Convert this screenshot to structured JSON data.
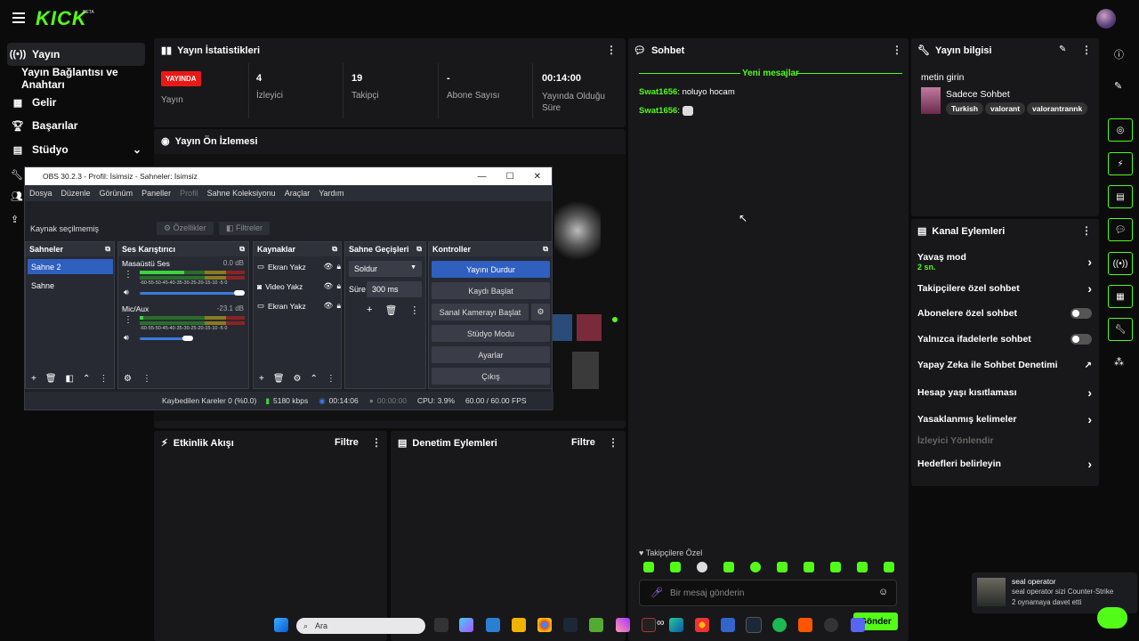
{
  "header": {
    "logo": "KICK",
    "beta": "BETA"
  },
  "nav": {
    "items": [
      {
        "label": "Yayın",
        "icon": "broadcast-icon"
      },
      {
        "label": "Yayın Bağlantısı ve Anahtarı"
      },
      {
        "label": "Gelir",
        "icon": "revenue-icon"
      },
      {
        "label": "Başarılar",
        "icon": "trophy-icon"
      },
      {
        "label": "Stüdyo",
        "icon": "studio-icon"
      }
    ]
  },
  "stats": {
    "title": "Yayın İstatistikleri",
    "live_badge": "YAYINDA",
    "live_label": "Yayın",
    "viewers_value": "4",
    "viewers_label": "İzleyici",
    "followers_value": "19",
    "followers_label": "Takipçi",
    "subs_value": "-",
    "subs_label": "Abone Sayısı",
    "duration_value": "00:14:00",
    "duration_label": "Yayında Olduğu Süre"
  },
  "preview": {
    "title": "Yayın Ön İzlemesi"
  },
  "obs": {
    "window_title": "OBS 30.2.3 - Profil: İsimsiz - Sahneler: İsimsiz",
    "menu": [
      "Dosya",
      "Düzenle",
      "Görünüm",
      "Paneller",
      "Profil",
      "Sahne Koleksiyonu",
      "Araçlar",
      "Yardım"
    ],
    "no_source": "Kaynak seçilmemiş",
    "properties_btn": "Özellikler",
    "filters_btn": "Filtreler",
    "docks": {
      "scenes": "Sahneler",
      "mixer": "Ses Karıştırıcı",
      "sources": "Kaynaklar",
      "transitions": "Sahne Geçişleri",
      "controls": "Kontroller"
    },
    "scenes": [
      "Sahne 2",
      "Sahne"
    ],
    "mixer": [
      {
        "name": "Masaüstü Ses",
        "db": "0.0 dB"
      },
      {
        "name": "Mic/Aux",
        "db": "-23.1 dB"
      }
    ],
    "scale": "-60-55-50-45-40-35-30-25-20-15-10 -5 0",
    "sources": [
      "Ekran Yakz",
      "Video Yakz",
      "Ekran Yakz"
    ],
    "transition_type": "Soldur",
    "duration_label": "Süre",
    "duration_value": "300 ms",
    "controls": [
      "Yayını Durdur",
      "Kaydı Başlat",
      "Sanal Kamerayı Başlat",
      "Stüdyo Modu",
      "Ayarlar",
      "Çıkış"
    ],
    "status": {
      "dropped": "Kaybedilen Kareler 0 (%0.0)",
      "bitrate": "5180 kbps",
      "stream_time": "00:14:06",
      "rec_time": "00:00:00",
      "cpu": "CPU: 3.9%",
      "fps": "60.00 / 60.00 FPS"
    }
  },
  "activity": {
    "title": "Etkinlik Akışı",
    "filter": "Filtre"
  },
  "moderation": {
    "title": "Denetim Eylemleri",
    "filter": "Filtre"
  },
  "chat": {
    "title": "Sohbet",
    "new_messages": "Yeni mesajlar",
    "messages": [
      {
        "user": "Swat1656",
        "text": "noluyo hocam"
      },
      {
        "user": "Swat1656",
        "text": ""
      }
    ],
    "followers_only": "Takipçilere Özel",
    "input_placeholder": "Bir mesaj gönderin",
    "send": "Gönder"
  },
  "stream_info": {
    "title": "Yayın bilgisi",
    "stream_title": "metin girin",
    "category": "Sadece Sohbet",
    "tags": [
      "Turkish",
      "valorant",
      "valorantrannk"
    ]
  },
  "channel_actions": {
    "title": "Kanal Eylemleri",
    "slow_mode": "Yavaş mod",
    "slow_mode_value": "2 sn.",
    "items": [
      {
        "label": "Takipçilere özel sohbet",
        "type": "chevron"
      },
      {
        "label": "Abonelere özel sohbet",
        "type": "toggle"
      },
      {
        "label": "Yalnızca ifadelerle sohbet",
        "type": "toggle"
      },
      {
        "label": "Yapay Zeka ile Sohbet Denetimi",
        "type": "external"
      },
      {
        "label": "Hesap yaşı kısıtlaması",
        "type": "chevron"
      },
      {
        "label": "Yasaklanmış kelimeler",
        "type": "chevron"
      }
    ],
    "raid": "İzleyici Yönlendir",
    "goals": "Hedefleri belirleyin"
  },
  "notification": {
    "title": "seal operator",
    "line1": "seal operator sizi Counter-Strike",
    "line2": "2 oynamaya davet etti"
  },
  "taskbar": {
    "search": "Ara"
  }
}
